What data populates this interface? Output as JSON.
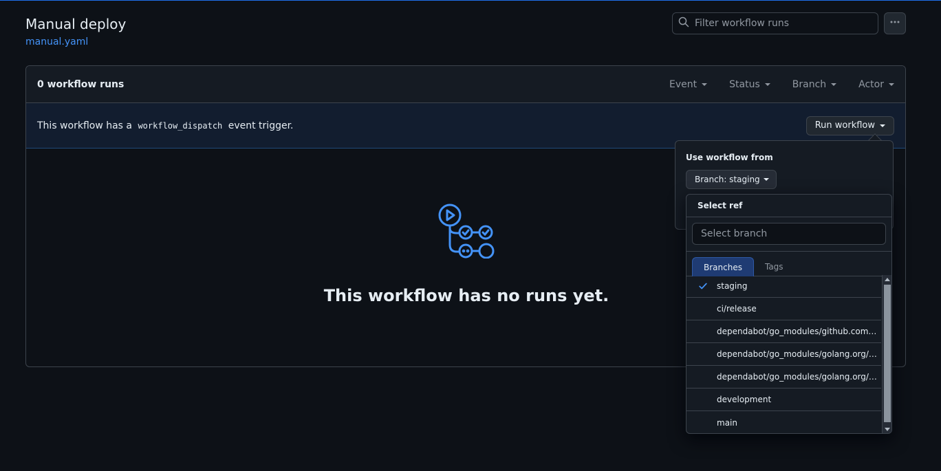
{
  "header": {
    "title": "Manual deploy",
    "file_link": "manual.yaml"
  },
  "search": {
    "placeholder": "Filter workflow runs"
  },
  "runs": {
    "count_label": "0 workflow runs",
    "filters": [
      "Event",
      "Status",
      "Branch",
      "Actor"
    ]
  },
  "dispatch": {
    "text_before": "This workflow has a",
    "code": "workflow_dispatch",
    "text_after": "event trigger.",
    "run_button": "Run workflow"
  },
  "empty_state": {
    "title": "This workflow has no runs yet."
  },
  "run_panel": {
    "use_label": "Use workflow from",
    "branch_button": "Branch: staging"
  },
  "ref_menu": {
    "heading": "Select ref",
    "filter_placeholder": "Select branch",
    "tabs": [
      "Branches",
      "Tags"
    ],
    "items": [
      "staging",
      "ci/release",
      "dependabot/go_modules/github.com…",
      "dependabot/go_modules/golang.org/…",
      "dependabot/go_modules/golang.org/…",
      "development",
      "main"
    ],
    "selected": "staging"
  },
  "colors": {
    "background": "#0d1117",
    "accent": "#4493f8",
    "border": "#3d444d",
    "dispatch_bg": "#121d2f"
  }
}
